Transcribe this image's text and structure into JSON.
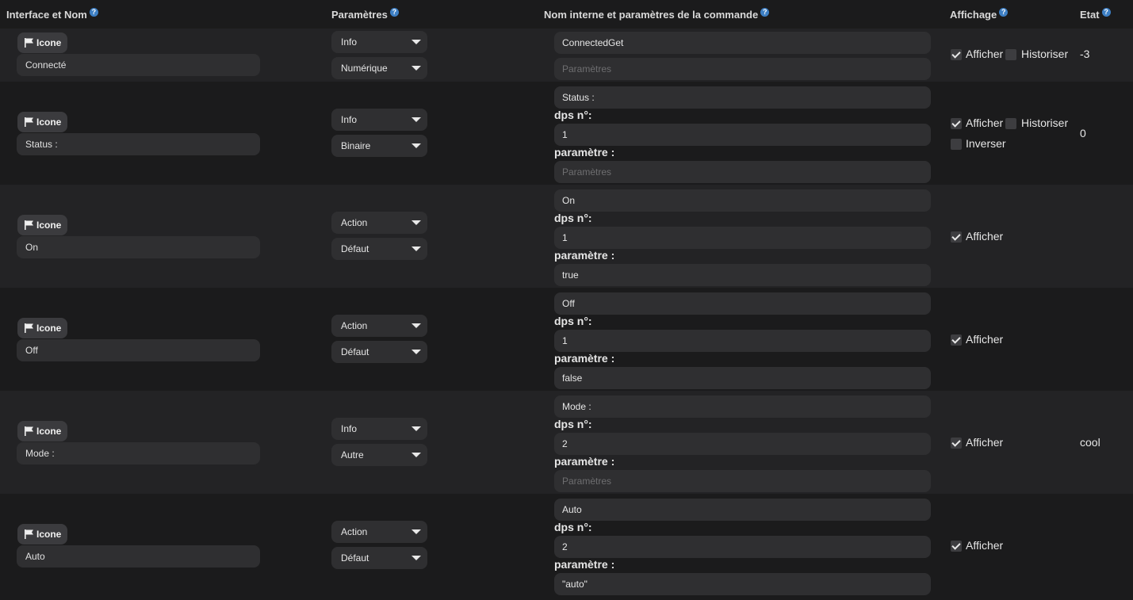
{
  "headers": {
    "interface": "Interface et Nom",
    "params": "Paramètres",
    "internal": "Nom interne et paramètres de la commande",
    "display": "Affichage",
    "state": "Etat"
  },
  "labels": {
    "icon": "Icone",
    "dps": "dps n°:",
    "parametre": "paramètre :",
    "param_placeholder": "Paramètres",
    "afficher": "Afficher",
    "historiser": "Historiser",
    "inverser": "Inverser"
  },
  "rows": [
    {
      "name": "Connecté",
      "type": "Info",
      "subtype": "Numérique",
      "internal": "ConnectedGet",
      "dps": "",
      "param": "",
      "afficher": true,
      "historiser": false,
      "inverser": null,
      "state": "-3"
    },
    {
      "name": "Status :",
      "type": "Info",
      "subtype": "Binaire",
      "internal": "Status :",
      "dps": "1",
      "param": "",
      "afficher": true,
      "historiser": false,
      "inverser": false,
      "state": "0"
    },
    {
      "name": "On",
      "type": "Action",
      "subtype": "Défaut",
      "internal": "On",
      "dps": "1",
      "param": "true",
      "afficher": true,
      "historiser": null,
      "inverser": null,
      "state": ""
    },
    {
      "name": "Off",
      "type": "Action",
      "subtype": "Défaut",
      "internal": "Off",
      "dps": "1",
      "param": "false",
      "afficher": true,
      "historiser": null,
      "inverser": null,
      "state": ""
    },
    {
      "name": "Mode :",
      "type": "Info",
      "subtype": "Autre",
      "internal": "Mode :",
      "dps": "2",
      "param": "",
      "afficher": true,
      "historiser": null,
      "inverser": null,
      "state": "cool"
    },
    {
      "name": "Auto",
      "type": "Action",
      "subtype": "Défaut",
      "internal": "Auto",
      "dps": "2",
      "param": "\"auto\"",
      "afficher": true,
      "historiser": null,
      "inverser": null,
      "state": ""
    }
  ]
}
